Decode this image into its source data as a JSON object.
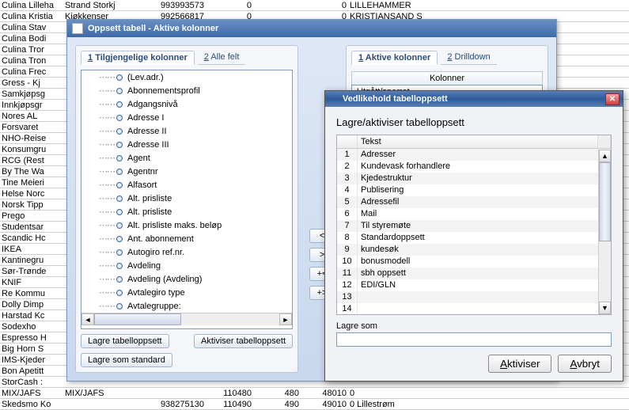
{
  "bg_rows": [
    {
      "c1": "Culina Lilleha",
      "c2": "Strand Storkj",
      "c3": "993993573",
      "c4": "0",
      "c5": "",
      "c6": "0",
      "c7": "LILLEHAMMER"
    },
    {
      "c1": "Culina Kristia",
      "c2": "Kjøkkenser",
      "c3": "992566817",
      "c4": "0",
      "c5": "",
      "c6": "0",
      "c7": "KRISTIANSAND S"
    },
    {
      "c1": "Culina Stav",
      "c2": "",
      "c3": "",
      "c4": "",
      "c5": "",
      "c6": "",
      "c7": ""
    },
    {
      "c1": "Culina Bodi",
      "c2": "",
      "c3": "",
      "c4": "",
      "c5": "",
      "c6": "",
      "c7": ""
    },
    {
      "c1": "Culina Tror",
      "c2": "",
      "c3": "",
      "c4": "",
      "c5": "",
      "c6": "",
      "c7": ""
    },
    {
      "c1": "Culina Tron",
      "c2": "",
      "c3": "",
      "c4": "",
      "c5": "",
      "c6": "",
      "c7": ""
    },
    {
      "c1": "Culina Frec",
      "c2": "",
      "c3": "",
      "c4": "",
      "c5": "",
      "c6": "",
      "c7": ""
    },
    {
      "c1": "Gress - Kj",
      "c2": "",
      "c3": "",
      "c4": "",
      "c5": "",
      "c6": "",
      "c7": ""
    },
    {
      "c1": "Samkjøpsg",
      "c2": "",
      "c3": "",
      "c4": "",
      "c5": "",
      "c6": "",
      "c7": ""
    },
    {
      "c1": "Innkjøpsgr",
      "c2": "",
      "c3": "",
      "c4": "",
      "c5": "",
      "c6": "",
      "c7": ""
    },
    {
      "c1": "Nores AL",
      "c2": "",
      "c3": "",
      "c4": "",
      "c5": "",
      "c6": "",
      "c7": ""
    },
    {
      "c1": "Forsvaret",
      "c2": "",
      "c3": "",
      "c4": "",
      "c5": "",
      "c6": "",
      "c7": ""
    },
    {
      "c1": "NHO-Reise",
      "c2": "",
      "c3": "",
      "c4": "",
      "c5": "",
      "c6": "",
      "c7": ""
    },
    {
      "c1": "Konsumgru",
      "c2": "",
      "c3": "",
      "c4": "",
      "c5": "",
      "c6": "",
      "c7": ""
    },
    {
      "c1": "RCG (Rest",
      "c2": "",
      "c3": "",
      "c4": "",
      "c5": "",
      "c6": "",
      "c7": ""
    },
    {
      "c1": "By The Wa",
      "c2": "",
      "c3": "",
      "c4": "",
      "c5": "",
      "c6": "",
      "c7": ""
    },
    {
      "c1": "Tine Meieri",
      "c2": "",
      "c3": "",
      "c4": "",
      "c5": "",
      "c6": "",
      "c7": ""
    },
    {
      "c1": "Helse Norc",
      "c2": "",
      "c3": "",
      "c4": "",
      "c5": "",
      "c6": "",
      "c7": ""
    },
    {
      "c1": "Norsk Tipp",
      "c2": "",
      "c3": "",
      "c4": "",
      "c5": "",
      "c6": "",
      "c7": ""
    },
    {
      "c1": "Prego",
      "c2": "",
      "c3": "",
      "c4": "",
      "c5": "",
      "c6": "",
      "c7": ""
    },
    {
      "c1": "Studentsar",
      "c2": "",
      "c3": "",
      "c4": "",
      "c5": "",
      "c6": "",
      "c7": ""
    },
    {
      "c1": "Scandic Hc",
      "c2": "",
      "c3": "",
      "c4": "",
      "c5": "",
      "c6": "",
      "c7": ""
    },
    {
      "c1": "IKEA",
      "c2": "",
      "c3": "",
      "c4": "",
      "c5": "",
      "c6": "",
      "c7": ""
    },
    {
      "c1": "Kantinegru",
      "c2": "",
      "c3": "",
      "c4": "",
      "c5": "",
      "c6": "",
      "c7": ""
    },
    {
      "c1": "Sør-Trønde",
      "c2": "",
      "c3": "",
      "c4": "",
      "c5": "",
      "c6": "",
      "c7": ""
    },
    {
      "c1": "KNIF",
      "c2": "",
      "c3": "",
      "c4": "",
      "c5": "",
      "c6": "",
      "c7": ""
    },
    {
      "c1": "Re Kommu",
      "c2": "",
      "c3": "",
      "c4": "",
      "c5": "",
      "c6": "",
      "c7": ""
    },
    {
      "c1": "Dolly Dimp",
      "c2": "",
      "c3": "",
      "c4": "",
      "c5": "",
      "c6": "",
      "c7": ""
    },
    {
      "c1": "Harstad Kc",
      "c2": "",
      "c3": "",
      "c4": "",
      "c5": "",
      "c6": "",
      "c7": ""
    },
    {
      "c1": "Sodexho",
      "c2": "",
      "c3": "",
      "c4": "",
      "c5": "",
      "c6": "",
      "c7": ""
    },
    {
      "c1": "Espresso H",
      "c2": "",
      "c3": "",
      "c4": "",
      "c5": "",
      "c6": "",
      "c7": ""
    },
    {
      "c1": "Big Horn S",
      "c2": "",
      "c3": "",
      "c4": "",
      "c5": "",
      "c6": "",
      "c7": ""
    },
    {
      "c1": "IMS-Kjeder",
      "c2": "",
      "c3": "",
      "c4": "",
      "c5": "",
      "c6": "",
      "c7": ""
    },
    {
      "c1": "Bon Apetitt",
      "c2": "",
      "c3": "",
      "c4": "",
      "c5": "",
      "c6": "",
      "c7": ""
    },
    {
      "c1": "StorCash :",
      "c2": "",
      "c3": "",
      "c4": "",
      "c5": "",
      "c6": "",
      "c7": ""
    },
    {
      "c1": "MIX/JAFS",
      "c2": "MIX/JAFS",
      "c3": "",
      "c4": "110480",
      "c5": "480",
      "c6": "48010",
      "c7": "0"
    },
    {
      "c1": "Skedsmo Ko",
      "c2": "",
      "c3": "938275130",
      "c4": "110490",
      "c5": "490",
      "c6": "49010",
      "c7": "0   Lillestrøm"
    }
  ],
  "dialog1": {
    "title": "Oppsett tabell - Aktive kolonner",
    "tabs_left": [
      {
        "num": "1",
        "label": "Tilgjengelige kolonner"
      },
      {
        "num": "2",
        "label": "Alle felt"
      }
    ],
    "tabs_right": [
      {
        "num": "1",
        "label": "Aktive kolonner"
      },
      {
        "num": "2",
        "label": "Drilldown"
      }
    ],
    "right_header": "Kolonner",
    "right_item": "Utgått/sperret",
    "tree": [
      "(Lev.adr.)",
      "Abonnementsprofil",
      "Adgangsnivå",
      "Adresse I",
      "Adresse II",
      "Adresse III",
      "Agent",
      "Agentnr",
      "Alfasort",
      "Alt. prisliste",
      "Alt. prisliste",
      "Alt. prisliste maks. beløp",
      "Ant. abonnement",
      "Autogiro ref.nr.",
      "Avdeling",
      "Avdeling (Avdeling)",
      "Avtalegiro type",
      "Avtalegruppe:"
    ],
    "move_btns": [
      "<",
      ">",
      "+<",
      "+>"
    ],
    "footer_left": [
      "Lagre tabelloppsett",
      "Lagre som standard"
    ],
    "footer_right": "Aktiviser tabelloppsett"
  },
  "dialog2": {
    "title": "Vedlikehold tabelloppsett",
    "heading": "Lagre/aktiviser tabelloppsett",
    "col_header": "Tekst",
    "rows": [
      "Adresser",
      "Kundevask forhandlere",
      "Kjedestruktur",
      "Publisering",
      "Adressefil",
      "Mail",
      "Til styremøte",
      "Standardoppsett",
      "kundesøk",
      "bonusmodell",
      "sbh oppsett",
      "EDI/GLN",
      "",
      ""
    ],
    "lagre_som_label": "Lagre som",
    "lagre_som_value": "",
    "btn_activate": "Aktiviser",
    "btn_cancel": "Avbryt"
  }
}
